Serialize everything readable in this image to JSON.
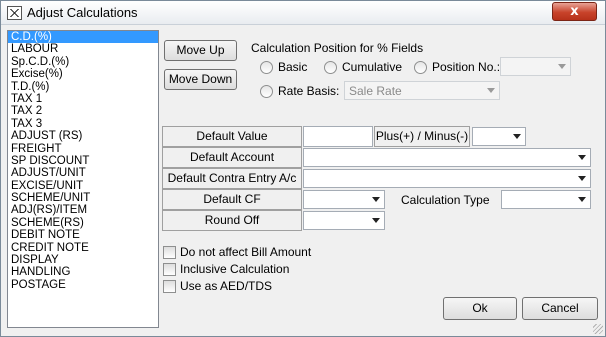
{
  "window": {
    "title": "Adjust Calculations",
    "close_label": "x"
  },
  "list": {
    "items": [
      "C.D.(%)",
      "LABOUR",
      "Sp.C.D.(%)",
      "Excise(%)",
      "T.D.(%)",
      "TAX 1",
      "TAX 2",
      "TAX 3",
      "ADJUST (RS)",
      "FREIGHT",
      "SP DISCOUNT",
      "ADJUST/UNIT",
      "EXCISE/UNIT",
      "SCHEME/UNIT",
      "ADJ(RS)/ITEM",
      "SCHEME(RS)",
      "DEBIT NOTE",
      "CREDIT NOTE",
      "DISPLAY",
      "HANDLING",
      "POSTAGE"
    ],
    "selected": "C.D.(%)"
  },
  "buttons": {
    "move_up": "Move Up",
    "move_down": "Move Down",
    "ok": "Ok",
    "cancel": "Cancel"
  },
  "calc_position": {
    "heading": "Calculation Position for % Fields",
    "basic": "Basic",
    "cumulative": "Cumulative",
    "position_no": "Position No.:",
    "position_no_value": "",
    "rate_basis": "Rate Basis:",
    "rate_basis_value": "Sale Rate"
  },
  "fields": {
    "default_value_label": "Default Value",
    "default_value": "",
    "plus_minus_label": "Plus(+) / Minus(-)",
    "plus_minus_value": "",
    "default_account_label": "Default Account",
    "default_account_value": "",
    "contra_label": "Default Contra Entry A/c",
    "contra_value": "",
    "default_cf_label": "Default CF",
    "default_cf_value": "",
    "calc_type_label": "Calculation Type",
    "calc_type_value": "",
    "round_off_label": "Round Off",
    "round_off_value": ""
  },
  "checkboxes": {
    "no_bill_amount": "Do not affect Bill Amount",
    "inclusive": "Inclusive Calculation",
    "aed_tds": "Use as AED/TDS"
  }
}
